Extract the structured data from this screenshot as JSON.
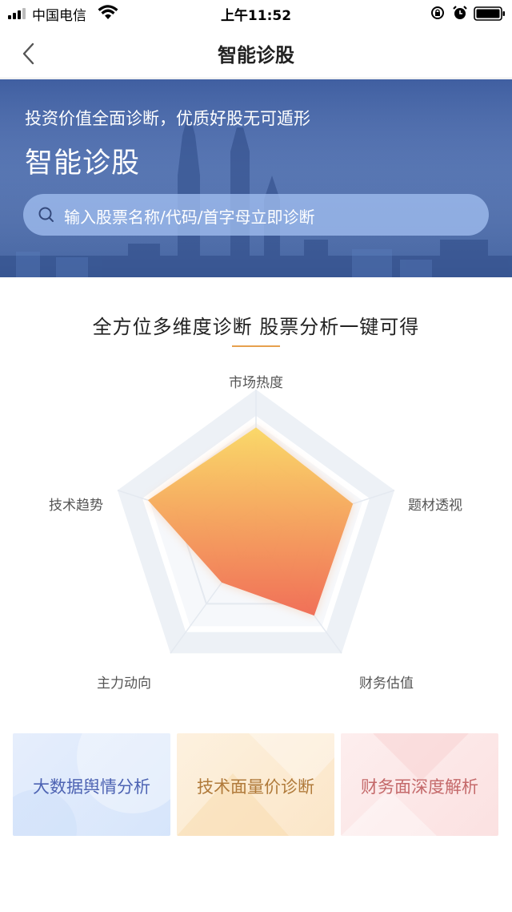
{
  "status_bar": {
    "carrier": "中国电信",
    "time": "上午11:52"
  },
  "nav": {
    "title": "智能诊股"
  },
  "banner": {
    "slogan": "投资价值全面诊断，优质好股无可遁形",
    "title": "智能诊股"
  },
  "search": {
    "placeholder": "输入股票名称/代码/首字母立即诊断"
  },
  "section": {
    "title": "全方位多维度诊断 股票分析一键可得"
  },
  "radar": {
    "axes": [
      "市场热度",
      "题材透视",
      "财务估值",
      "主力动向",
      "技术趋势"
    ],
    "values": [
      0.74,
      0.7,
      0.68,
      0.4,
      0.78
    ],
    "fill_top_color": "#fad864",
    "fill_bottom_color": "#f06a52"
  },
  "cards": [
    {
      "label": "大数据舆情分析"
    },
    {
      "label": "技术面量价诊断"
    },
    {
      "label": "财务面深度解析"
    }
  ],
  "colors": {
    "accent": "#e7a04e",
    "banner": "#3f60a6"
  },
  "icons": {
    "back": "chevron-left-icon",
    "search": "search-icon",
    "wifi": "wifi-icon",
    "alarm": "alarm-icon",
    "battery": "battery-icon"
  }
}
